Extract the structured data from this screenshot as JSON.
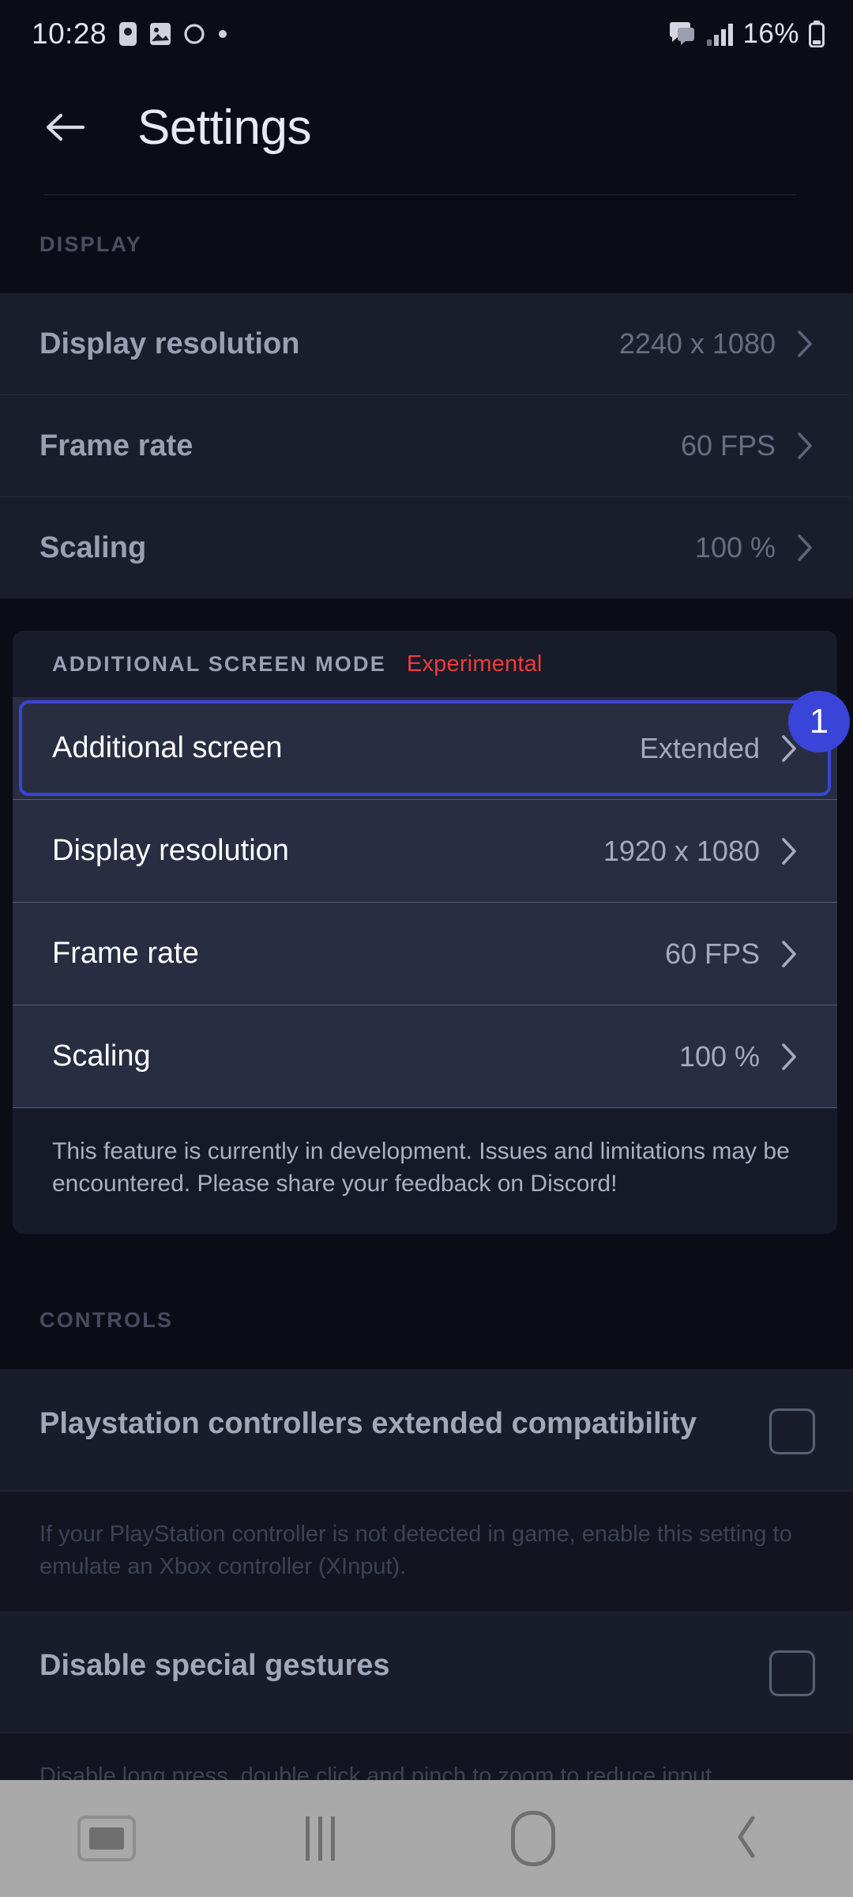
{
  "status_bar": {
    "time": "10:28",
    "battery_percent": "16%",
    "left_icons": [
      "phone-app-icon",
      "image-icon",
      "circle-icon",
      "dot-icon"
    ],
    "right_icons": [
      "message-icon",
      "signal-bars-icon",
      "battery-icon"
    ]
  },
  "header": {
    "back_icon": "back-arrow-icon",
    "title": "Settings"
  },
  "display_section": {
    "label": "DISPLAY",
    "rows": [
      {
        "label": "Display resolution",
        "value": "2240 x 1080"
      },
      {
        "label": "Frame rate",
        "value": "60 FPS"
      },
      {
        "label": "Scaling",
        "value": "100 %"
      }
    ]
  },
  "additional_screen_section": {
    "label": "ADDITIONAL SCREEN MODE",
    "tag": "Experimental",
    "tag_color": "#ef3b3b",
    "highlight_color": "#3b44d8",
    "badge": "1",
    "rows": [
      {
        "label": "Additional screen",
        "value": "Extended"
      },
      {
        "label": "Display resolution",
        "value": "1920 x 1080"
      },
      {
        "label": "Frame rate",
        "value": "60 FPS"
      },
      {
        "label": "Scaling",
        "value": "100 %"
      }
    ],
    "description": "This feature is currently in development. Issues and limitations may be encountered. Please share your feedback on Discord!"
  },
  "controls_section": {
    "label": "CONTROLS",
    "items": [
      {
        "label": "Playstation controllers extended compatibility",
        "checked": false,
        "description": "If your PlayStation controller is not detected in game, enable this setting to emulate an Xbox controller (XInput)."
      },
      {
        "label": "Disable special gestures",
        "checked": false,
        "description": "Disable long press, double click and pinch to zoom to reduce input"
      }
    ]
  },
  "nav_bar": {
    "buttons": [
      "keyboard-icon",
      "recents-icon",
      "home-icon",
      "back-icon"
    ]
  }
}
